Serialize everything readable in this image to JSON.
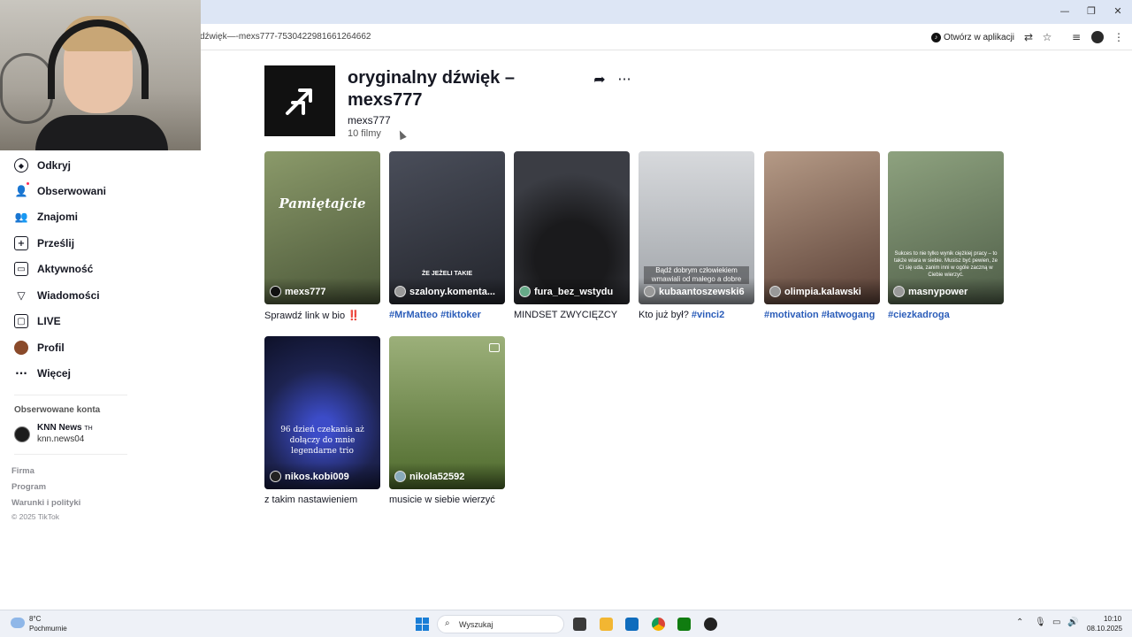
{
  "browser": {
    "url": "dźwięk—-mexs777-7530422981661264662",
    "open_in_app": "Otwórz w aplikacji",
    "window_controls": [
      "—",
      "❐",
      "✕"
    ]
  },
  "sidebar": {
    "items": [
      {
        "label": "Odkryj",
        "icon": "compass-icon"
      },
      {
        "label": "Obserwowani",
        "icon": "following-icon"
      },
      {
        "label": "Znajomi",
        "icon": "friends-icon"
      },
      {
        "label": "Prześlij",
        "icon": "upload-icon"
      },
      {
        "label": "Aktywność",
        "icon": "activity-icon"
      },
      {
        "label": "Wiadomości",
        "icon": "messages-icon"
      },
      {
        "label": "LIVE",
        "icon": "live-icon"
      },
      {
        "label": "Profil",
        "icon": "profile-avatar"
      },
      {
        "label": "Więcej",
        "icon": "more-icon"
      }
    ],
    "followed_title": "Obserwowane konta",
    "followed_accounts": [
      {
        "name": "KNN News",
        "badge": "TH",
        "handle": "knn.news04"
      }
    ],
    "footer_links": [
      "Firma",
      "Program",
      "Warunki i polityki"
    ],
    "copyright": "© 2025 TikTok"
  },
  "sound": {
    "title": "oryginalny dźwięk – mexs777",
    "author": "mexs777",
    "count": "10 filmy"
  },
  "videos": [
    {
      "user": "mexs777",
      "caption_text": "Sprawdź link w bio ",
      "caption_extra": "‼️",
      "tags": [],
      "overlay": "Pamiętajcie",
      "bg": "#6b7a52"
    },
    {
      "user": "szalony.komenta...",
      "caption_text": "",
      "tags": [
        "#MrMatteo",
        "#tiktoker"
      ],
      "overlay": "ŻE JEŻELI TAKIE",
      "bg": "#3a3d46"
    },
    {
      "user": "fura_bez_wstydu",
      "caption_text": "MINDSET ZWYCIĘZCY",
      "tags": [],
      "overlay": "",
      "bg": "#2b2c31"
    },
    {
      "user": "kubaantoszewski6",
      "caption_text": "Kto już był? ",
      "tags": [
        "#vinci2"
      ],
      "overlay": "Bądź dobrym człowiekiem wmawiali od małego a dobre",
      "bg": "#c9cbcf"
    },
    {
      "user": "olimpia.kalawski",
      "caption_text": "",
      "tags": [
        "#motivation",
        "#łatwogang"
      ],
      "overlay": "",
      "bg": "#8a6b58"
    },
    {
      "user": "masnypower",
      "caption_text": "",
      "tags": [
        "#ciezkadroga"
      ],
      "overlay": "Sukces to nie tylko wynik ciężkiej pracy – to także wiara w siebie. Musisz być pewien, że Ci się uda, zanim inni w ogóle zaczną w Ciebie wierzyć.",
      "bg": "#6f7f6a"
    },
    {
      "user": "nikos.kobi009",
      "caption_text": "z takim nastawieniem",
      "tags": [],
      "overlay": "96 dzień czekania aż dołączy do mnie legendarne trio",
      "bg": "#1d2350"
    },
    {
      "user": "nikola52592",
      "caption_text": "musicie w siebie wierzyć",
      "tags": [],
      "overlay": "",
      "bg": "#5f7a3a"
    }
  ],
  "taskbar": {
    "temp": "8°C",
    "weather": "Pochmurnie",
    "search_placeholder": "Wyszukaj",
    "time": "10:10",
    "date": "08.10.2025"
  }
}
